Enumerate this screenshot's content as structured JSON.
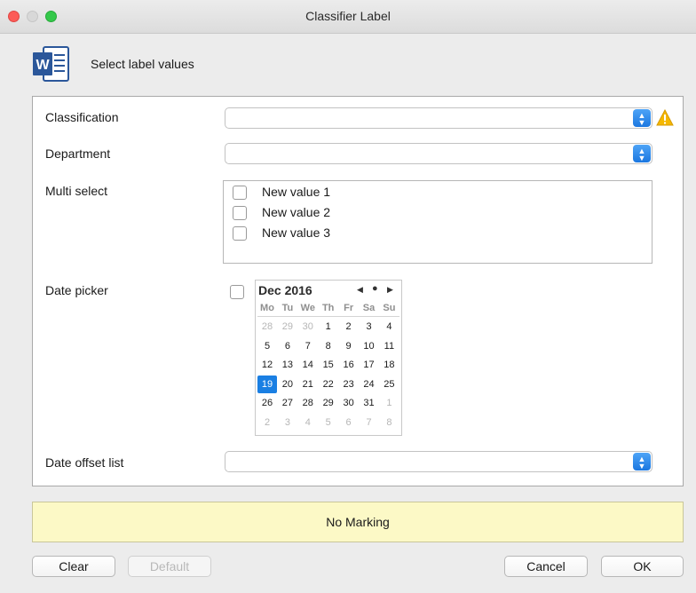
{
  "window": {
    "title": "Classifier Label"
  },
  "header": {
    "text": "Select label values",
    "app_icon": "word-icon",
    "app_icon_letter": "W"
  },
  "form": {
    "classification": {
      "label": "Classification",
      "value": ""
    },
    "department": {
      "label": "Department",
      "value": ""
    },
    "multi_select": {
      "label": "Multi select",
      "items": [
        {
          "label": "New value 1",
          "checked": false
        },
        {
          "label": "New value 2",
          "checked": false
        },
        {
          "label": "New value 3",
          "checked": false
        }
      ]
    },
    "date_picker": {
      "label": "Date picker",
      "enabled": false,
      "calendar": {
        "month": "Dec 2016",
        "weekdays": [
          "Mo",
          "Tu",
          "We",
          "Th",
          "Fr",
          "Sa",
          "Su"
        ],
        "weeks": [
          [
            "28",
            "29",
            "30",
            "1",
            "2",
            "3",
            "4"
          ],
          [
            "5",
            "6",
            "7",
            "8",
            "9",
            "10",
            "11"
          ],
          [
            "12",
            "13",
            "14",
            "15",
            "16",
            "17",
            "18"
          ],
          [
            "19",
            "20",
            "21",
            "22",
            "23",
            "24",
            "25"
          ],
          [
            "26",
            "27",
            "28",
            "29",
            "30",
            "31",
            "1"
          ],
          [
            "2",
            "3",
            "4",
            "5",
            "6",
            "7",
            "8"
          ]
        ],
        "selected_day": "19"
      }
    },
    "date_offset_list": {
      "label": "Date offset list",
      "value": ""
    }
  },
  "marking": {
    "text": "No Marking"
  },
  "buttons": {
    "clear": "Clear",
    "default": "Default",
    "cancel": "Cancel",
    "ok": "OK"
  },
  "colors": {
    "accent": "#1a7fe3",
    "marking_bg": "#fcf9c6",
    "warning": "#f5b800",
    "word_blue": "#2b579a"
  }
}
